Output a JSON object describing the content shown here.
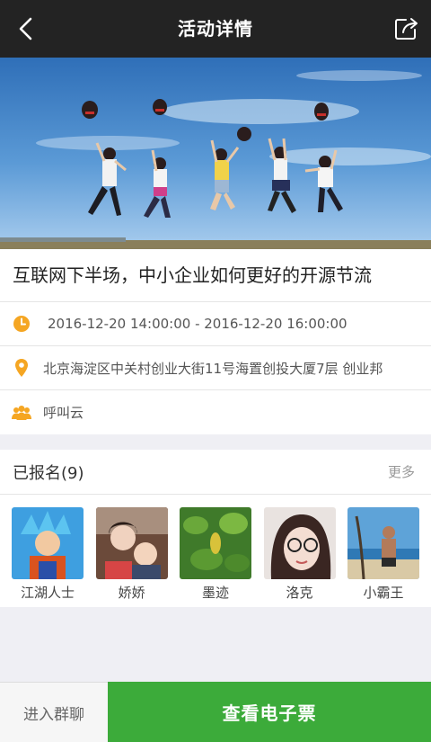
{
  "header": {
    "title": "活动详情"
  },
  "event": {
    "title": "互联网下半场，中小企业如何更好的开源节流",
    "time": "2016-12-20 14:00:00 - 2016-12-20 16:00:00",
    "address": "北京海淀区中关村创业大街11号海置创投大厦7层 创业邦",
    "organizer": "呼叫云"
  },
  "attendees": {
    "label": "已报名(9)",
    "more": "更多",
    "people": [
      {
        "name": "江湖人士"
      },
      {
        "name": "娇娇"
      },
      {
        "name": "墨迹"
      },
      {
        "name": "洛克"
      },
      {
        "name": "小霸王"
      }
    ]
  },
  "actions": {
    "chat": "进入群聊",
    "ticket": "查看电子票"
  },
  "colors": {
    "accent": "#f5a623",
    "primary": "#3cab3a",
    "header": "#232323"
  }
}
